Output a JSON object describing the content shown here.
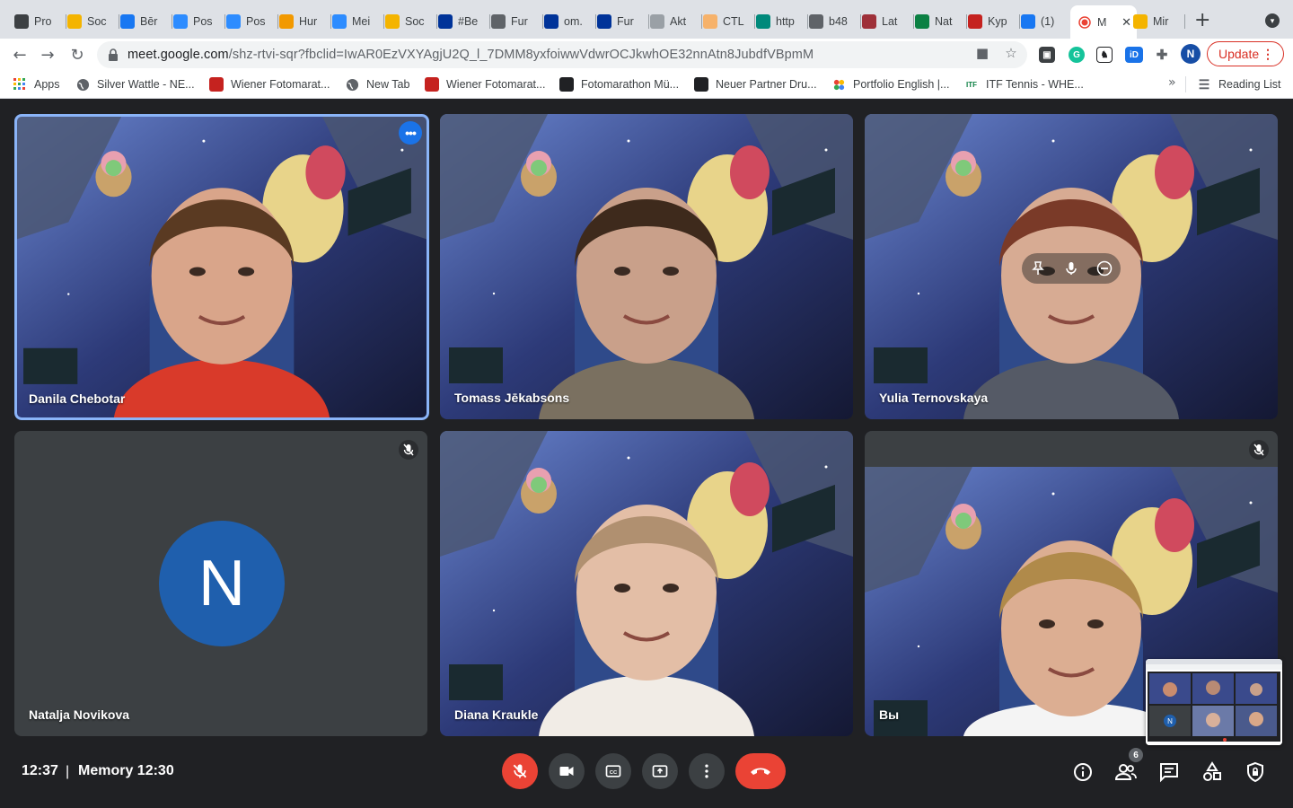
{
  "browser": {
    "tabs": [
      {
        "label": "Pro",
        "icon": "proton-icon",
        "color": "#3c4043"
      },
      {
        "label": "Soc",
        "icon": "hand-icon",
        "color": "#f4b400"
      },
      {
        "label": "Bēr",
        "icon": "facebook-icon",
        "color": "#1877f2"
      },
      {
        "label": "Pos",
        "icon": "zoom-icon",
        "color": "#2d8cff"
      },
      {
        "label": "Pos",
        "icon": "zoom-icon",
        "color": "#2d8cff"
      },
      {
        "label": "Hur",
        "icon": "bolt-icon",
        "color": "#f29900"
      },
      {
        "label": "Mei",
        "icon": "zoom-icon",
        "color": "#2d8cff"
      },
      {
        "label": "Soc",
        "icon": "hand-icon",
        "color": "#f4b400"
      },
      {
        "label": "#Be",
        "icon": "eu-flag-icon",
        "color": "#003399"
      },
      {
        "label": "Fur",
        "icon": "globe-icon",
        "color": "#5f6368"
      },
      {
        "label": "om.",
        "icon": "eu-flag-icon",
        "color": "#003399"
      },
      {
        "label": "Fur",
        "icon": "eu-flag-icon",
        "color": "#003399"
      },
      {
        "label": "Akt",
        "icon": "chart-icon",
        "color": "#9aa0a6"
      },
      {
        "label": "CTL",
        "icon": "ctl-icon",
        "color": "#f6b26b"
      },
      {
        "label": "http",
        "icon": "globe-color-icon",
        "color": "#00897b"
      },
      {
        "label": "b48",
        "icon": "globe-icon",
        "color": "#5f6368"
      },
      {
        "label": "Lat",
        "icon": "latvia-flag-icon",
        "color": "#9e3039"
      },
      {
        "label": "Nat",
        "icon": "itf-icon",
        "color": "#0b8043"
      },
      {
        "label": "Kyp",
        "icon": "likh-icon",
        "color": "#c5221f"
      },
      {
        "label": "(1)",
        "icon": "facebook-icon",
        "color": "#1877f2"
      },
      {
        "label": "M",
        "icon": "record-icon",
        "color": "#ea4335",
        "active": true
      },
      {
        "label": "Mir",
        "icon": "slides-icon",
        "color": "#f4b400"
      }
    ],
    "url_host": "meet.google.com",
    "url_path": "/shz-rtvi-sqr?fbclid=IwAR0EzVXYAgjU2Q_l_7DMM8yxfoiwwVdwrOCJkwhOE32nnAtn8JubdfVBpmM",
    "update_label": "Update",
    "profile_initial": "N",
    "bookmarks": [
      {
        "label": "Apps",
        "icon": "apps-grid-icon"
      },
      {
        "label": "Silver Wattle - NE...",
        "icon": "globe-icon"
      },
      {
        "label": "Wiener Fotomarat...",
        "icon": "photo-marathon-icon"
      },
      {
        "label": "New Tab",
        "icon": "globe-icon"
      },
      {
        "label": "Wiener Fotomarat...",
        "icon": "photo-marathon-icon"
      },
      {
        "label": "Fotomarathon Mü...",
        "icon": "camera-icon"
      },
      {
        "label": "Neuer Partner Dru...",
        "icon": "camera-icon"
      },
      {
        "label": "Portfolio English |...",
        "icon": "portfolio-icon"
      },
      {
        "label": "ITF Tennis - WHE...",
        "icon": "itf-icon"
      }
    ],
    "reading_list_label": "Reading List"
  },
  "meet": {
    "participants": [
      {
        "name": "Danila Chebotar",
        "selected": true,
        "muted": false,
        "camera": true
      },
      {
        "name": "Tomass Jēkabsons",
        "muted": false,
        "camera": true
      },
      {
        "name": "Yulia Ternovskaya",
        "muted": false,
        "camera": true,
        "hover": true
      },
      {
        "name": "Natalja Novikova",
        "muted": true,
        "camera": false,
        "initial": "N"
      },
      {
        "name": "Diana Kraukle",
        "muted": false,
        "camera": true
      },
      {
        "name": "Вы",
        "muted": true,
        "camera": true
      }
    ],
    "time": "12:37",
    "meeting_name": "Memory 12:30",
    "participant_count": "6",
    "colors": {
      "background": "#202124",
      "control": "#3c4043",
      "danger": "#ea4335",
      "accent": "#8ab4f8",
      "avatar": "#1f5fad"
    }
  }
}
